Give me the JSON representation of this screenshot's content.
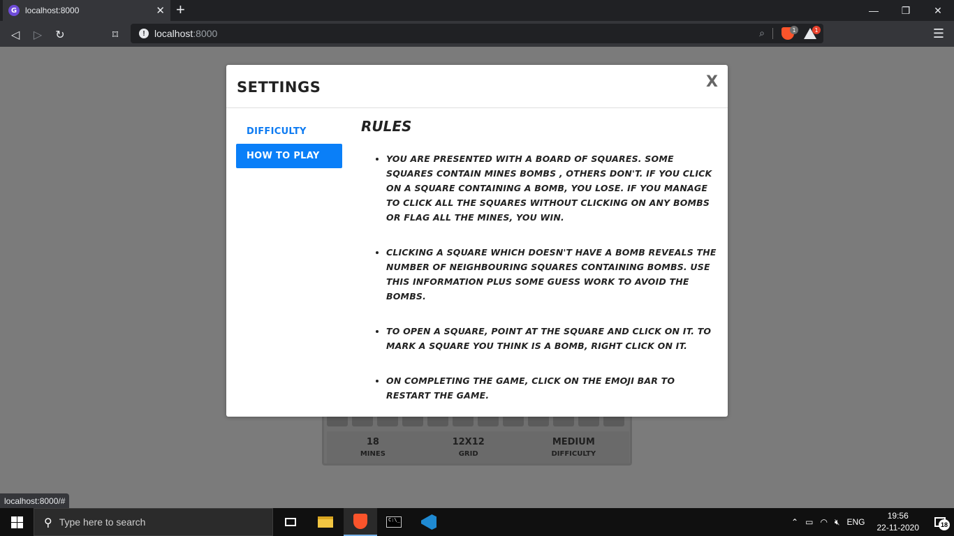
{
  "browser": {
    "tab_title": "localhost:8000",
    "url_host": "localhost",
    "url_port": ":8000",
    "status_url": "localhost:8000/#",
    "brave_shield_count": "1",
    "rewards_count": "1"
  },
  "modal": {
    "title": "SETTINGS",
    "close_label": "X",
    "nav": [
      {
        "label": "DIFFICULTY",
        "active": false
      },
      {
        "label": "HOW TO PLAY",
        "active": true
      }
    ],
    "rules_title": "RULES",
    "rules": [
      "You are presented with a board of squares. Some squares contain mines  bombs , others don't. If you click on a square containing a bomb, you lose. If you manage to click all the squares  without clicking on any bombs  or flag all the mines, you win.",
      "Clicking a square which doesn't have a bomb reveals the number of neighbouring squares containing bombs. Use this information plus some guess work to avoid the bombs.",
      "To open a square, point at the square and click on it. To mark a square you think is a bomb, right click on it.",
      "On completing the game, click on the emoji bar to restart the game."
    ]
  },
  "game": {
    "stats": [
      {
        "value": "18",
        "label": "MINES"
      },
      {
        "value": "12X12",
        "label": "GRID"
      },
      {
        "value": "MEDIUM",
        "label": "DIFFICULTY"
      }
    ],
    "visible_cells": 12
  },
  "taskbar": {
    "search_placeholder": "Type here to search",
    "language": "ENG",
    "time": "19:56",
    "date": "22-11-2020",
    "notification_count": "18"
  },
  "colors": {
    "accent": "#0a7ff8",
    "overlay": "#7b7b7b"
  }
}
